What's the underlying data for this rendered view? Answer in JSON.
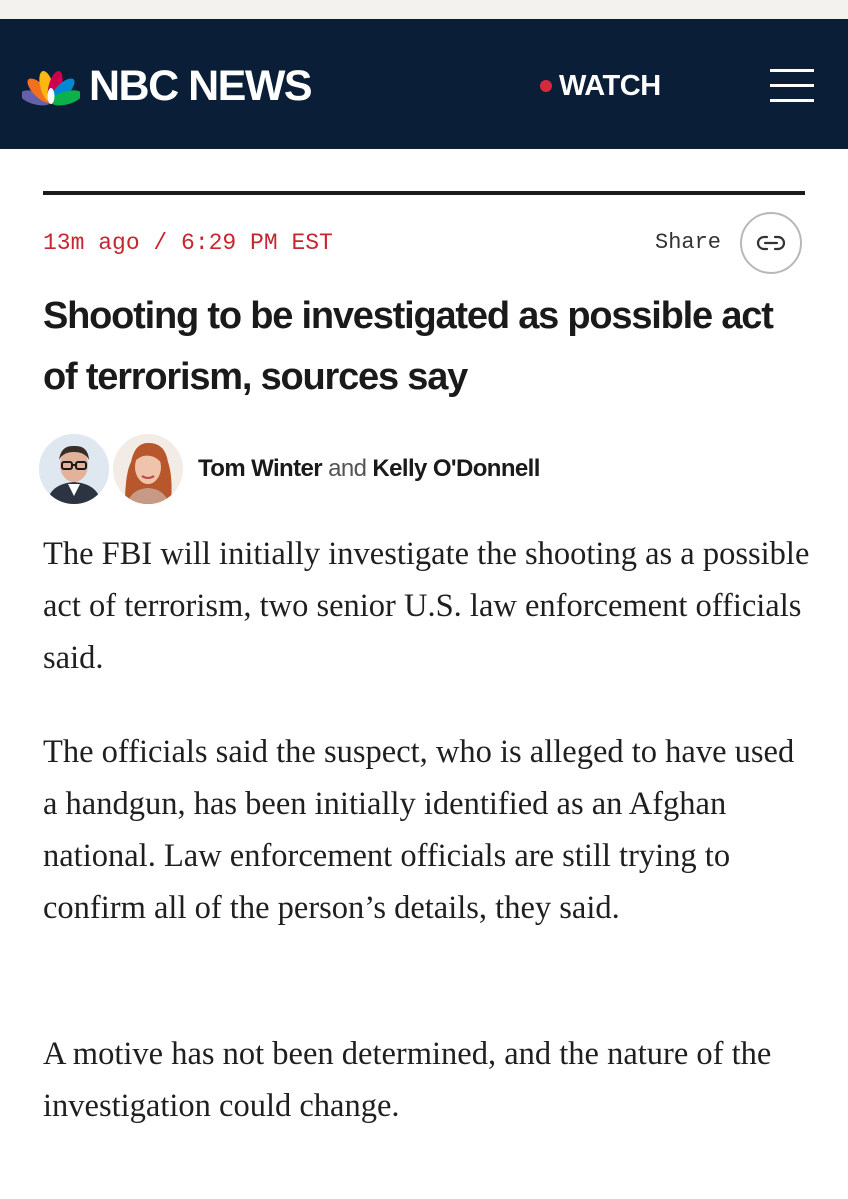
{
  "header": {
    "brand": "NBC NEWS",
    "watch_label": "WATCH",
    "colors": {
      "navbar": "#0b1e37",
      "live_dot": "#d6293b"
    }
  },
  "article": {
    "timestamp": "13m ago / 6:29 PM EST",
    "share_label": "Share",
    "share_icon": "link-icon",
    "headline": "Shooting to be investigated as possible act of terrorism, sources say",
    "authors": [
      "Tom Winter",
      "Kelly O'Donnell"
    ],
    "author_conjunction": "and",
    "paragraphs": [
      "The FBI will initially investigate the shooting as a possible act of terrorism, two senior U.S. law enforcement officials said.",
      "The officials said the suspect, who is alleged to have used a handgun, has been initially identified as an Afghan national. Law enforcement officials are still trying to confirm all of the person’s details, they said.",
      "A motive has not been determined, and the nature of the investigation could change."
    ],
    "colors": {
      "timestamp": "#c8262f"
    }
  }
}
